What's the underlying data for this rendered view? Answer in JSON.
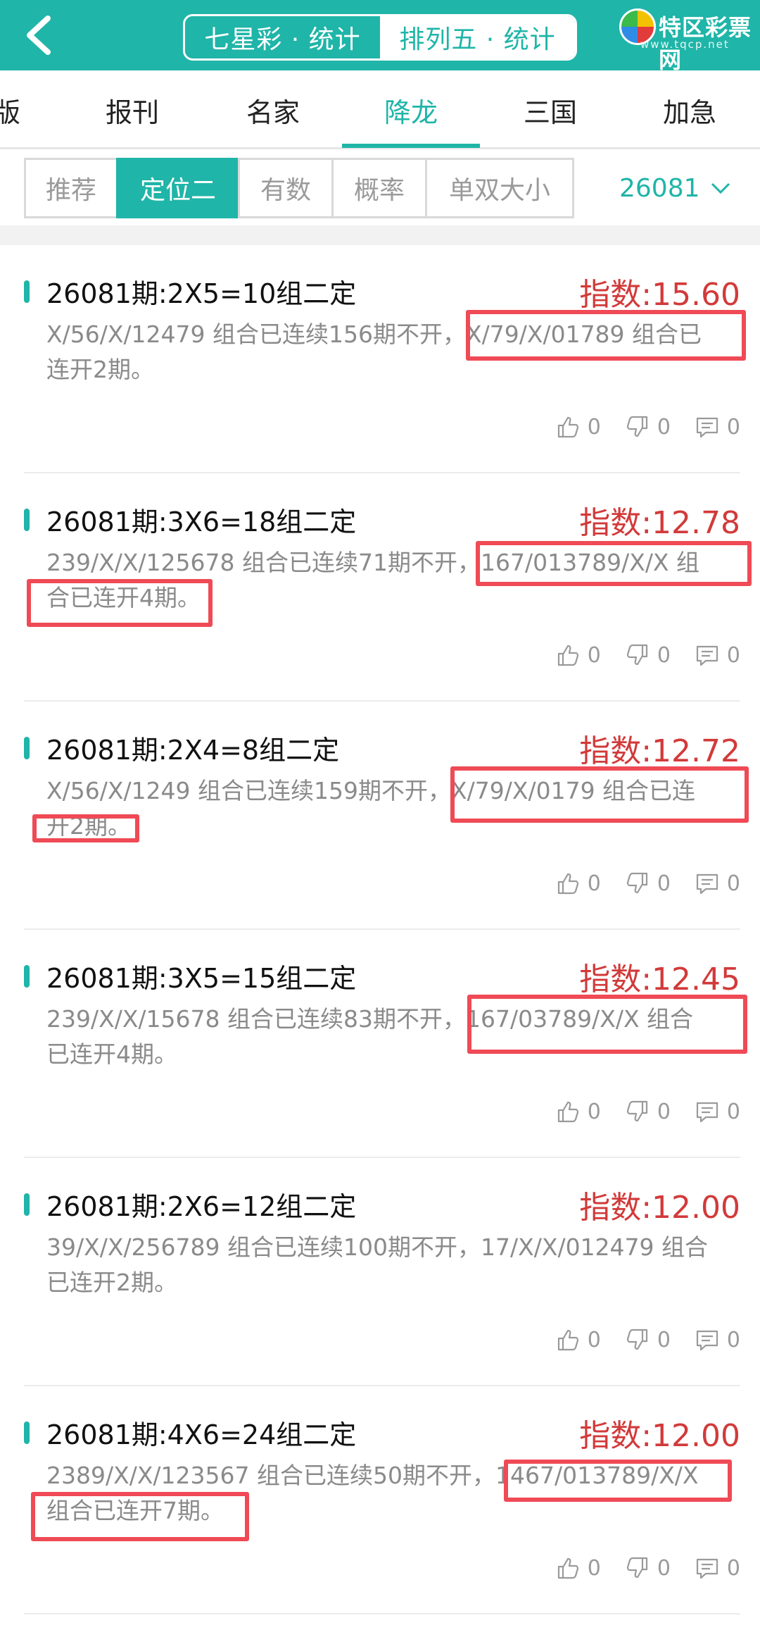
{
  "header": {
    "seg_left": "七星彩 · 统计",
    "seg_right": "排列五 · 统计",
    "logo_name": "特区彩票网",
    "logo_url": "www.tqcp.net"
  },
  "categories": [
    "版",
    "报刊",
    "名家",
    "降龙",
    "三国",
    "加急"
  ],
  "active_category": "降龙",
  "subtabs": [
    "推荐",
    "定位二",
    "有数",
    "概率",
    "单双大小"
  ],
  "active_subtab": "定位二",
  "period_select": "26081",
  "cards": [
    {
      "title": "26081期:2X5=10组二定",
      "index": "指数:15.60",
      "line1": "X/56/X/12479 组合已连续156期不开，X/79/X/01789 组合已",
      "line2": "连开2期。",
      "likes": "0",
      "dislikes": "0",
      "comments": "0"
    },
    {
      "title": "26081期:3X6=18组二定",
      "index": "指数:12.78",
      "line1": "239/X/X/125678 组合已连续71期不开，167/013789/X/X 组",
      "line2": "合已连开4期。",
      "likes": "0",
      "dislikes": "0",
      "comments": "0"
    },
    {
      "title": "26081期:2X4=8组二定",
      "index": "指数:12.72",
      "line1": "X/56/X/1249 组合已连续159期不开，X/79/X/0179 组合已连",
      "line2": "开2期。",
      "likes": "0",
      "dislikes": "0",
      "comments": "0"
    },
    {
      "title": "26081期:3X5=15组二定",
      "index": "指数:12.45",
      "line1": "239/X/X/15678 组合已连续83期不开，167/03789/X/X 组合",
      "line2": "已连开4期。",
      "likes": "0",
      "dislikes": "0",
      "comments": "0"
    },
    {
      "title": "26081期:2X6=12组二定",
      "index": "指数:12.00",
      "line1": "39/X/X/256789 组合已连续100期不开，17/X/X/012479 组合",
      "line2": "已连开2期。",
      "likes": "0",
      "dislikes": "0",
      "comments": "0"
    },
    {
      "title": "26081期:4X6=24组二定",
      "index": "指数:12.00",
      "line1": "2389/X/X/123567 组合已连续50期不开，1467/013789/X/X",
      "line2": "组合已连开7期。",
      "likes": "0",
      "dislikes": "0",
      "comments": "0"
    }
  ],
  "colors": {
    "accent": "#1fb5a8",
    "index_red": "#d23a3a",
    "highlight": "#ef4a55"
  }
}
